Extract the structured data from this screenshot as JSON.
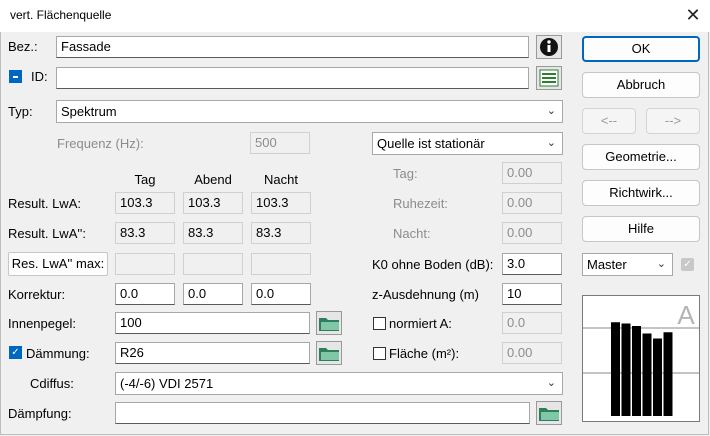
{
  "window": {
    "title": "vert. Flächenquelle",
    "close_glyph": "✕"
  },
  "bez": {
    "label": "Bez.:",
    "value": "Fassade"
  },
  "id": {
    "label": "ID:",
    "value": ""
  },
  "typ": {
    "label": "Typ:",
    "value": "Spektrum"
  },
  "frequenz": {
    "label": "Frequenz (Hz):",
    "value": "500"
  },
  "quelle": {
    "value": "Quelle ist stationär"
  },
  "columns": {
    "tag": "Tag",
    "abend": "Abend",
    "nacht": "Nacht"
  },
  "result_lwa": {
    "label": "Result. LwA:",
    "tag": "103.3",
    "abend": "103.3",
    "nacht": "103.3"
  },
  "result_lwa2": {
    "label": "Result. LwA'':",
    "tag": "83.3",
    "abend": "83.3",
    "nacht": "83.3"
  },
  "res_lwa_max": {
    "label": "Res. LwA'' max:",
    "tag": "",
    "abend": "",
    "nacht": ""
  },
  "korrektur": {
    "label": "Korrektur:",
    "tag": "0.0",
    "abend": "0.0",
    "nacht": "0.0"
  },
  "innenpegel": {
    "label": "Innenpegel:",
    "value": "100"
  },
  "daemmung": {
    "label": "Dämmung:",
    "value": "R26"
  },
  "cdiffus": {
    "label": "Cdiffus:",
    "value": "(-4/-6) VDI 2571"
  },
  "daempfung": {
    "label": "Dämpfung:",
    "value": ""
  },
  "times": {
    "tag_label": "Tag:",
    "tag_value": "0.00",
    "ruhezeit_label": "Ruhezeit:",
    "ruhezeit_value": "0.00",
    "nacht_label": "Nacht:",
    "nacht_value": "0.00"
  },
  "k0": {
    "label": "K0 ohne Boden (dB):",
    "value": "3.0"
  },
  "z": {
    "label": "z-Ausdehnung (m)",
    "value": "10"
  },
  "normiert": {
    "label": "normiert A:",
    "value": "0.0"
  },
  "flaeche": {
    "label": "Fläche (m²):",
    "value": "0.00"
  },
  "buttons": {
    "ok": "OK",
    "abbruch": "Abbruch",
    "prev": "<--",
    "next": "-->",
    "geometrie": "Geometrie...",
    "richtwirk": "Richtwirk...",
    "hilfe": "Hilfe"
  },
  "master": {
    "value": "Master"
  },
  "spectrum": {
    "letter": "A",
    "bars": [
      0.75,
      0.74,
      0.72,
      0.66,
      0.62,
      0.67
    ]
  },
  "colors": {
    "accent": "#0067c0"
  }
}
